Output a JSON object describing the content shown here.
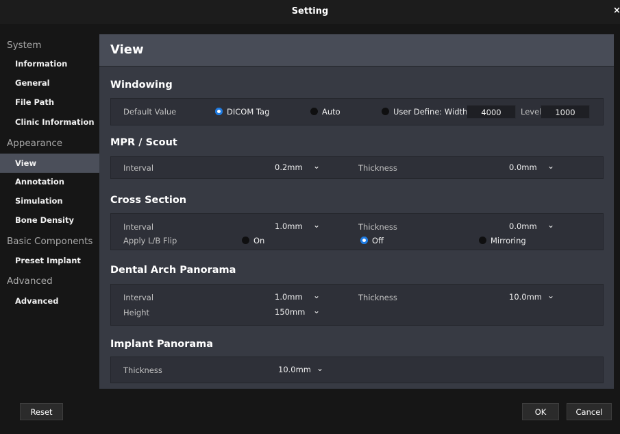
{
  "window": {
    "title": "Setting",
    "close_glyph": "×"
  },
  "sidebar": {
    "system": {
      "label": "System",
      "items": [
        "Information",
        "General",
        "File Path",
        "Clinic Information"
      ]
    },
    "appearance": {
      "label": "Appearance",
      "items": [
        "View",
        "Annotation",
        "Simulation",
        "Bone Density"
      ]
    },
    "basic": {
      "label": "Basic Components",
      "items": [
        "Preset Implant"
      ]
    },
    "advanced": {
      "label": "Advanced",
      "items": [
        "Advanced"
      ]
    },
    "active_item": "View"
  },
  "main": {
    "title": "View",
    "windowing": {
      "title": "Windowing",
      "default_label": "Default Value",
      "options": [
        "DICOM Tag",
        "Auto",
        "User Define: Width"
      ],
      "selected": "DICOM Tag",
      "width_value": "4000",
      "level_label": "Level",
      "level_value": "1000"
    },
    "mpr": {
      "title": "MPR / Scout",
      "interval_label": "Interval",
      "interval_value": "0.2mm",
      "thickness_label": "Thickness",
      "thickness_value": "0.0mm"
    },
    "cross": {
      "title": "Cross Section",
      "interval_label": "Interval",
      "interval_value": "1.0mm",
      "thickness_label": "Thickness",
      "thickness_value": "0.0mm",
      "flip_label": "Apply L/B Flip",
      "flip_options": [
        "On",
        "Off",
        "Mirroring"
      ],
      "flip_selected": "Off"
    },
    "dental": {
      "title": "Dental Arch Panorama",
      "interval_label": "Interval",
      "interval_value": "1.0mm",
      "thickness_label": "Thickness",
      "thickness_value": "10.0mm",
      "height_label": "Height",
      "height_value": "150mm"
    },
    "implant": {
      "title": "Implant Panorama",
      "thickness_label": "Thickness",
      "thickness_value": "10.0mm"
    }
  },
  "footer": {
    "reset": "Reset",
    "ok": "OK",
    "cancel": "Cancel"
  },
  "colors": {
    "accent": "#1f7ae0",
    "panel": "#373a43",
    "background": "#161616"
  },
  "icons": {
    "dropdown": "chevron-down-icon",
    "close": "close-icon"
  }
}
